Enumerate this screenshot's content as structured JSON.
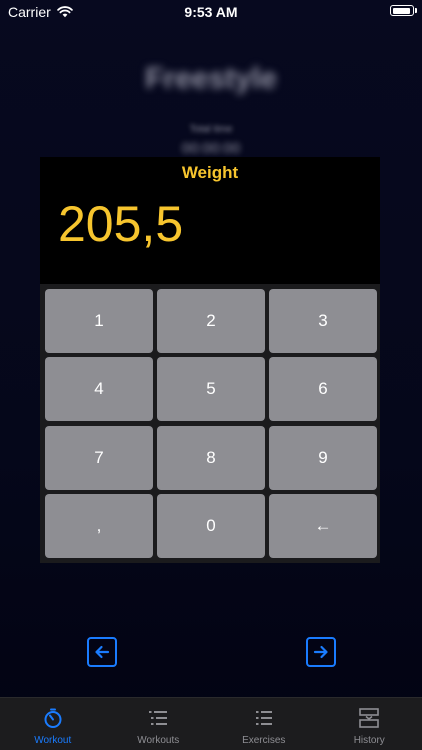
{
  "status_bar": {
    "carrier": "Carrier",
    "time": "9:53 AM"
  },
  "background": {
    "title": "Freestyle",
    "subtitle": "Total time",
    "value": "00:00:00"
  },
  "keypad": {
    "title": "Weight",
    "value": "205,5",
    "keys": [
      "1",
      "2",
      "3",
      "4",
      "5",
      "6",
      "7",
      "8",
      "9",
      ",",
      "0",
      "←"
    ]
  },
  "navigation": {
    "prev_icon": "arrow-left-icon",
    "next_icon": "arrow-right-icon"
  },
  "tabbar": {
    "tabs": [
      {
        "label": "Workout",
        "icon": "stopwatch-icon",
        "active": true
      },
      {
        "label": "Workouts",
        "icon": "list-icon",
        "active": false
      },
      {
        "label": "Exercises",
        "icon": "list-icon",
        "active": false
      },
      {
        "label": "History",
        "icon": "history-icon",
        "active": false
      }
    ]
  },
  "colors": {
    "accent": "#f7c52e",
    "tint": "#1a7cff",
    "key": "#8e8e93"
  }
}
